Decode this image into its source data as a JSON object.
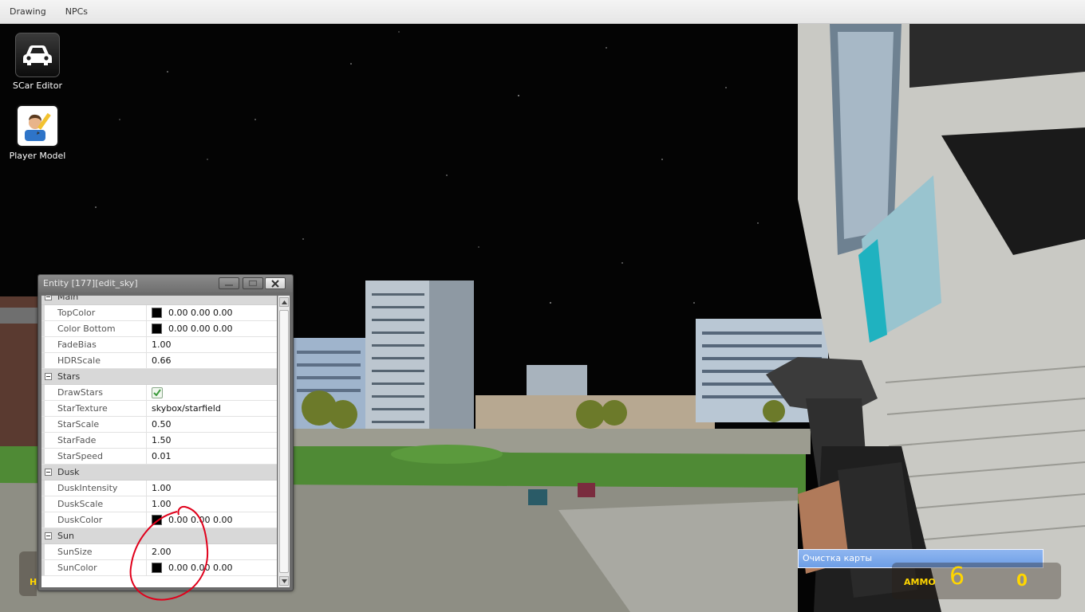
{
  "menu": {
    "items": [
      "Drawing",
      "NPCs"
    ]
  },
  "desktop": {
    "icons": [
      {
        "label": "SCar Editor",
        "icon": "car-icon"
      },
      {
        "label": "Player Model",
        "icon": "player-model-icon"
      }
    ]
  },
  "window": {
    "title": "Entity [177][edit_sky]",
    "sections": {
      "main": {
        "label": "Main",
        "rows": [
          {
            "name": "TopColor",
            "value": "0.00 0.00 0.00",
            "swatch": "#000000"
          },
          {
            "name": "Color Bottom",
            "value": "0.00 0.00 0.00",
            "swatch": "#000000"
          },
          {
            "name": "FadeBias",
            "value": "1.00"
          },
          {
            "name": "HDRScale",
            "value": "0.66"
          }
        ]
      },
      "stars": {
        "label": "Stars",
        "rows": [
          {
            "name": "DrawStars",
            "checked": true
          },
          {
            "name": "StarTexture",
            "value": "skybox/starfield"
          },
          {
            "name": "StarScale",
            "value": "0.50"
          },
          {
            "name": "StarFade",
            "value": "1.50"
          },
          {
            "name": "StarSpeed",
            "value": "0.01"
          }
        ]
      },
      "dusk": {
        "label": "Dusk",
        "rows": [
          {
            "name": "DuskIntensity",
            "value": "1.00"
          },
          {
            "name": "DuskScale",
            "value": "1.00"
          },
          {
            "name": "DuskColor",
            "value": "0.00 0.00 0.00",
            "swatch": "#000000"
          }
        ]
      },
      "sun": {
        "label": "Sun",
        "rows": [
          {
            "name": "SunSize",
            "value": "2.00"
          },
          {
            "name": "SunColor",
            "value": "0.00 0.00 0.00",
            "swatch": "#000000"
          }
        ]
      }
    }
  },
  "hud": {
    "notice": "Очистка карты",
    "ammo_label": "AMMO",
    "ammo_clip": "6",
    "ammo_reserve": "0",
    "health_label": "H",
    "accent_color": "#ffd600"
  },
  "colors": {
    "annotation": "#e0001b"
  }
}
